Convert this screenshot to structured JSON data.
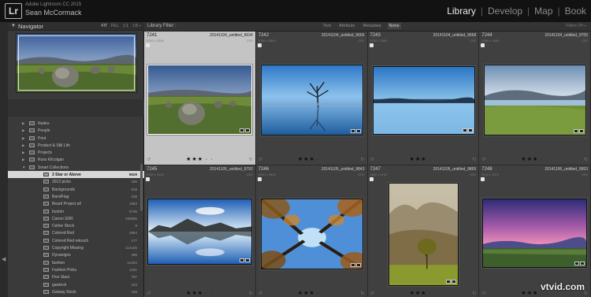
{
  "identity": {
    "logo": "Lr",
    "app_name": "Adobe Lightroom CC 2015",
    "user_name": "Sean McCormack"
  },
  "modules": [
    {
      "label": "Library",
      "active": true
    },
    {
      "label": "Develop",
      "active": false
    },
    {
      "label": "Map",
      "active": false
    },
    {
      "label": "Book",
      "active": false
    }
  ],
  "navigator": {
    "title": "Navigator",
    "zoom_options": [
      "FIT",
      "FILL",
      "1:1",
      "1:8 ÷"
    ]
  },
  "collections": [
    {
      "label": "Nudes",
      "count": "",
      "indent": 1,
      "folder": true
    },
    {
      "label": "People",
      "count": "",
      "indent": 1,
      "folder": true
    },
    {
      "label": "Print",
      "count": "",
      "indent": 1,
      "folder": true
    },
    {
      "label": "Product & Still Life",
      "count": "",
      "indent": 1,
      "folder": true
    },
    {
      "label": "Projects",
      "count": "",
      "indent": 1,
      "folder": true
    },
    {
      "label": "Ross Kilcolgan",
      "count": "",
      "indent": 1,
      "folder": true
    },
    {
      "label": "Smart Collections",
      "count": "",
      "indent": 1,
      "folder": true,
      "expanded": true
    },
    {
      "label": "3 Star or Above",
      "count": "8529",
      "indent": 2,
      "selected": true
    },
    {
      "label": "2012 picks",
      "count": "165",
      "indent": 2
    },
    {
      "label": "Backgrounds",
      "count": "618",
      "indent": 2
    },
    {
      "label": "BandFlag",
      "count": "238",
      "indent": 2
    },
    {
      "label": "Beard Project all",
      "count": "1863",
      "indent": 2
    },
    {
      "label": "buxton",
      "count": "5736",
      "indent": 2
    },
    {
      "label": "Canon SDR",
      "count": "159966",
      "indent": 2
    },
    {
      "label": "Celine Stock",
      "count": "9",
      "indent": 2
    },
    {
      "label": "Colored Red",
      "count": "4964",
      "indent": 2
    },
    {
      "label": "Colored Red retouch",
      "count": "177",
      "indent": 2
    },
    {
      "label": "Copyright Missing",
      "count": "114165",
      "indent": 2
    },
    {
      "label": "Dynaoigns",
      "count": "485",
      "indent": 2
    },
    {
      "label": "fashion",
      "count": "12404",
      "indent": 2
    },
    {
      "label": "Fashion Picks",
      "count": "1181",
      "indent": 2
    },
    {
      "label": "Five Stars",
      "count": "787",
      "indent": 2
    },
    {
      "label": "gaisteck",
      "count": "223",
      "indent": 2
    },
    {
      "label": "Galway Stock",
      "count": "188",
      "indent": 2
    }
  ],
  "filter_bar": {
    "title": "Library Filter :",
    "options": [
      {
        "label": "Text",
        "active": false
      },
      {
        "label": "Attribute",
        "active": false
      },
      {
        "label": "Metadata",
        "active": false
      },
      {
        "label": "None",
        "active": true
      }
    ],
    "right": "Filters Off ÷"
  },
  "photos": [
    {
      "num": "7241",
      "file": "20141104_untitled_9634",
      "dims": "5760 x 3840",
      "ext": "CR2",
      "stars": "★★★ · ·",
      "selected": true,
      "scene": "stones"
    },
    {
      "num": "7242",
      "file": "20141104_untitled_9666",
      "dims": "5760 x 3840",
      "ext": "CR2",
      "stars": "★★★ · ·",
      "selected": false,
      "scene": "tree"
    },
    {
      "num": "7243",
      "file": "20141104_untitled_9668",
      "dims": "5760 x 3840",
      "ext": "CR2",
      "stars": "★★★ · ·",
      "selected": false,
      "scene": "lake"
    },
    {
      "num": "7244",
      "file": "20141104_untitled_9755",
      "dims": "5760 x 3840",
      "ext": "CR2",
      "stars": "★★★ · ·",
      "selected": false,
      "scene": "meadow"
    },
    {
      "num": "7245",
      "file": "20141105_untitled_9792",
      "dims": "5760 x 3840",
      "ext": "CR2",
      "stars": "★★★ · ·",
      "selected": false,
      "scene": "reflection"
    },
    {
      "num": "7246",
      "file": "20141105_untitled_9843",
      "dims": "5760 x 3840",
      "ext": "CR2",
      "stars": "★★★ · ·",
      "selected": false,
      "scene": "canopy"
    },
    {
      "num": "7247",
      "file": "20141105_untitled_9865",
      "dims": "3840 x 5760",
      "ext": "CR2",
      "stars": "★★★ · ·",
      "selected": false,
      "scene": "portrait-tree"
    },
    {
      "num": "7248",
      "file": "20141106_untitled_9953",
      "dims": "5212 x 3474",
      "ext": "CR2",
      "stars": "★★★ · ·",
      "selected": false,
      "scene": "dusk"
    }
  ],
  "watermark": "vtvid.com"
}
